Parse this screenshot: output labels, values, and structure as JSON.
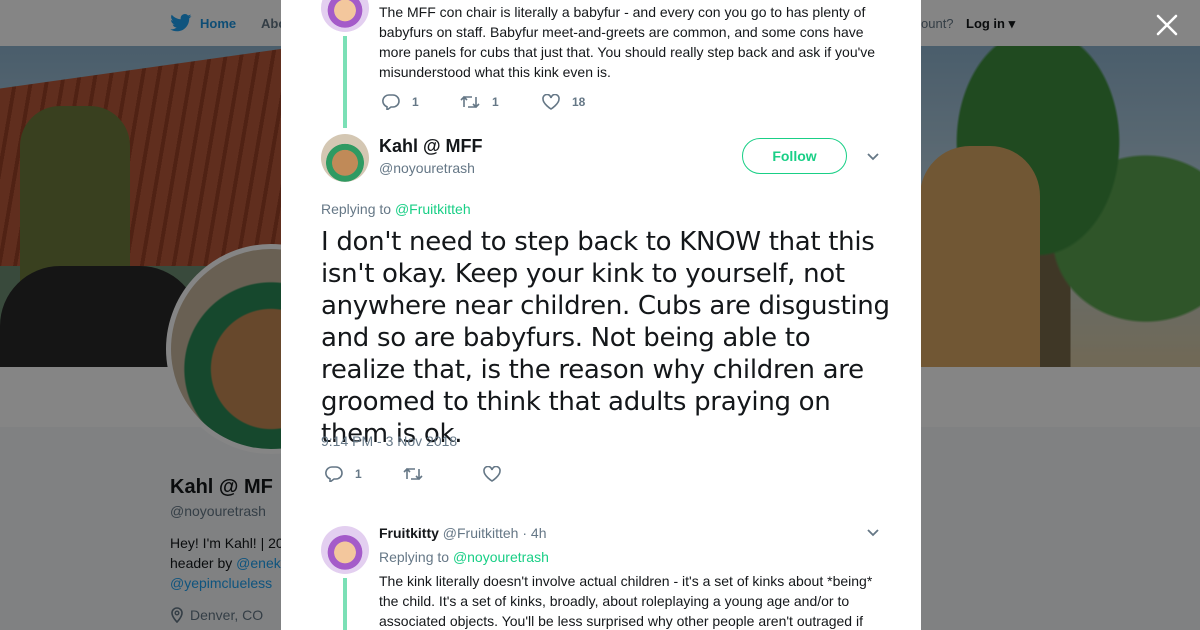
{
  "nav": {
    "home_label": "Home",
    "about_label": "Abo",
    "account_prompt": "ccount?",
    "login_label": "Log in"
  },
  "profile": {
    "name": "Kahl @ MF",
    "handle": "@noyouretrash",
    "bio_line1": "Hey! I'm Kahl! | 20",
    "bio_line2_prefix": "header by ",
    "bio_line2_link": "@enek",
    "bio_line3_link": "@yepimclueless",
    "location": "Denver, CO"
  },
  "modal": {
    "previous_tweet": {
      "text": "The MFF con chair is literally a babyfur - and every con you go to has plenty of babyfurs on staff. Babyfur meet-and-greets are common, and some cons have more panels for cubs that just that. You should really step back and ask if you've misunderstood what this kink even is.",
      "reply_count": "1",
      "retweet_count": "1",
      "like_count": "18"
    },
    "main_tweet": {
      "display_name": "Kahl @ MFF",
      "handle": "@noyouretrash",
      "follow_label": "Follow",
      "replying_prefix": "Replying to",
      "replying_to": "@Fruitkitteh",
      "text": "I don't need to step back to KNOW that this isn't okay. Keep your kink to yourself, not anywhere near children. Cubs are disgusting and so are babyfurs. Not being able to realize that, is the reason why children are groomed to think that adults praying on them is ok.",
      "timestamp": "9:14 PM - 3 Nov 2018",
      "reply_count": "1"
    },
    "reply_tweet": {
      "display_name": "Fruitkitty",
      "handle": "@Fruitkitteh",
      "age": "· 4h",
      "replying_prefix": "Replying to",
      "replying_to": "@noyouretrash",
      "text": "The kink literally doesn't involve actual children - it's a set of kinks about *being* the child. It's a set of kinks, broadly, about roleplaying a young age and/or to associated objects. You'll be less surprised why other people aren't outraged if"
    }
  },
  "colors": {
    "accent_green": "#19cf86",
    "thread_line": "#7be0b6",
    "twitter_blue": "#1da1f2",
    "muted_text": "#657786"
  },
  "icons": [
    "twitter-bird-icon",
    "close-icon",
    "reply-icon",
    "retweet-icon",
    "like-icon",
    "chevron-down-icon",
    "location-pin-icon"
  ]
}
